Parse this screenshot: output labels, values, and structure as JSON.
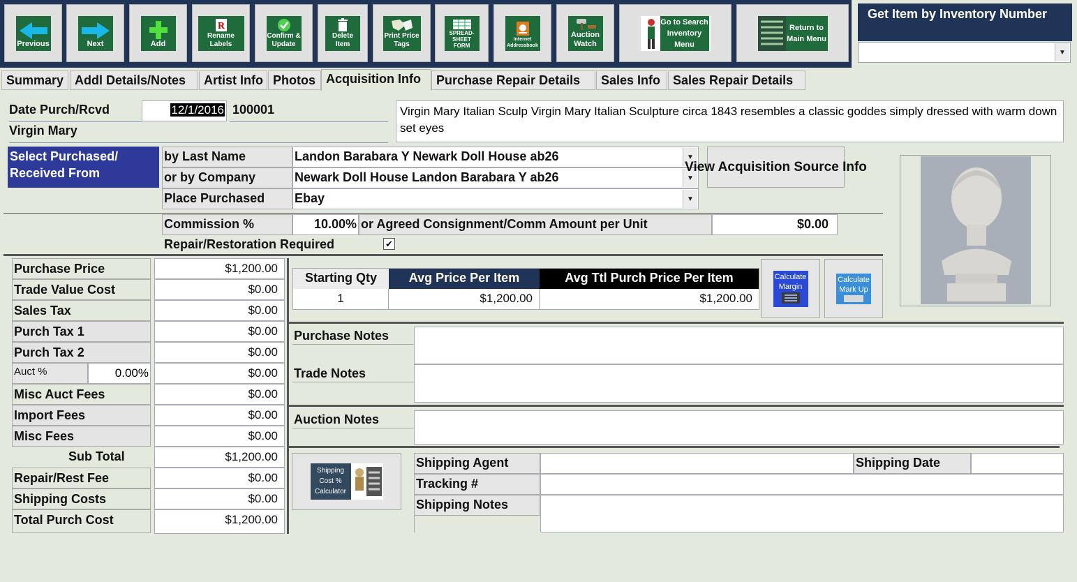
{
  "toolbar": {
    "previous": "Previous",
    "next": "Next",
    "add": "Add",
    "rename_labels": "Rename Labels",
    "confirm_update": "Confirm & Update",
    "delete_item": "Delete Item",
    "print_price_tags": "Print Price Tags",
    "spreadsheet_form": "SPREAD-SHEET FORM",
    "internet_addressbook": "Internet Addressbook",
    "auction_watch": "Auction Watch",
    "go_to_search": "Go to Search Inventory Menu",
    "return_to_main": "Return to Main Menu"
  },
  "get_item": {
    "title": "Get Item by Inventory Number",
    "value": ""
  },
  "tabs": [
    "Summary",
    "Addl Details/Notes",
    "Artist Info",
    "Photos",
    "Acquisition Info",
    "Purchase Repair Details",
    "Sales Info",
    "Sales Repair Details"
  ],
  "header": {
    "date_label": "Date Purch/Rcvd",
    "date_value": "12/1/2016",
    "inventory_number": "100001",
    "item_name": "Virgin Mary",
    "description": "Virgin Mary Italian Sculp Virgin Mary Italian Sculpture circa 1843 resembles a classic goddes simply dressed with warm down set eyes"
  },
  "source": {
    "select_label": "Select Purchased/ Received From",
    "by_last_name_label": "by Last Name",
    "by_last_name_value": "Landon  Barabara  Y    Newark Doll House  ab26",
    "by_company_label": "or by Company",
    "by_company_value": "Newark Doll House   Landon  Barabara  Y    ab26",
    "place_label": "Place Purchased",
    "place_value": "Ebay",
    "view_button": "View Acquisition Source Info"
  },
  "commission": {
    "label": "Commission %",
    "value": "10.00%",
    "agreed_label": "or Agreed Consignment/Comm Amount per Unit",
    "agreed_value": "$0.00",
    "repair_label": "Repair/Restoration Required",
    "repair_checked": "✔"
  },
  "costs": [
    {
      "label": "Purchase Price",
      "value": "$1,200.00"
    },
    {
      "label": "Trade Value Cost",
      "value": "$0.00"
    },
    {
      "label": "Sales Tax",
      "value": "$0.00"
    },
    {
      "label": "Purch Tax 1",
      "value": "$0.00"
    },
    {
      "label": "Purch Tax 2",
      "value": "$0.00"
    },
    {
      "label": "Auct %",
      "pct": "0.00%",
      "value": "$0.00"
    },
    {
      "label": "Misc Auct Fees",
      "value": "$0.00"
    },
    {
      "label": "Import Fees",
      "value": "$0.00"
    },
    {
      "label": "Misc Fees",
      "value": "$0.00"
    },
    {
      "label": "Sub Total",
      "value": "$1,200.00"
    },
    {
      "label": "Repair/Rest Fee",
      "value": "$0.00"
    },
    {
      "label": "Shipping Costs",
      "value": "$0.00"
    },
    {
      "label": "Total Purch Cost",
      "value": "$1,200.00"
    }
  ],
  "qty_table": {
    "starting_qty_label": "Starting Qty",
    "avg_price_label": "Avg Price Per Item",
    "avg_total_label": "Avg Ttl Purch Price Per Item",
    "starting_qty": "1",
    "avg_price": "$1,200.00",
    "avg_total": "$1,200.00"
  },
  "calc": {
    "margin": "Calculate Margin",
    "markup": "Calculate Mark Up",
    "shipping": "Shipping Cost % Calculator"
  },
  "notes": {
    "purchase": "Purchase Notes",
    "trade": "Trade Notes",
    "auction": "Auction Notes"
  },
  "shipping": {
    "agent": "Shipping Agent",
    "date": "Shipping Date",
    "tracking": "Tracking #",
    "notes": "Shipping Notes"
  },
  "colors": {
    "navy": "#1f3457",
    "green": "#1f6b3b",
    "background": "#e3e9dc",
    "header_blue": "#2e3a9a"
  }
}
